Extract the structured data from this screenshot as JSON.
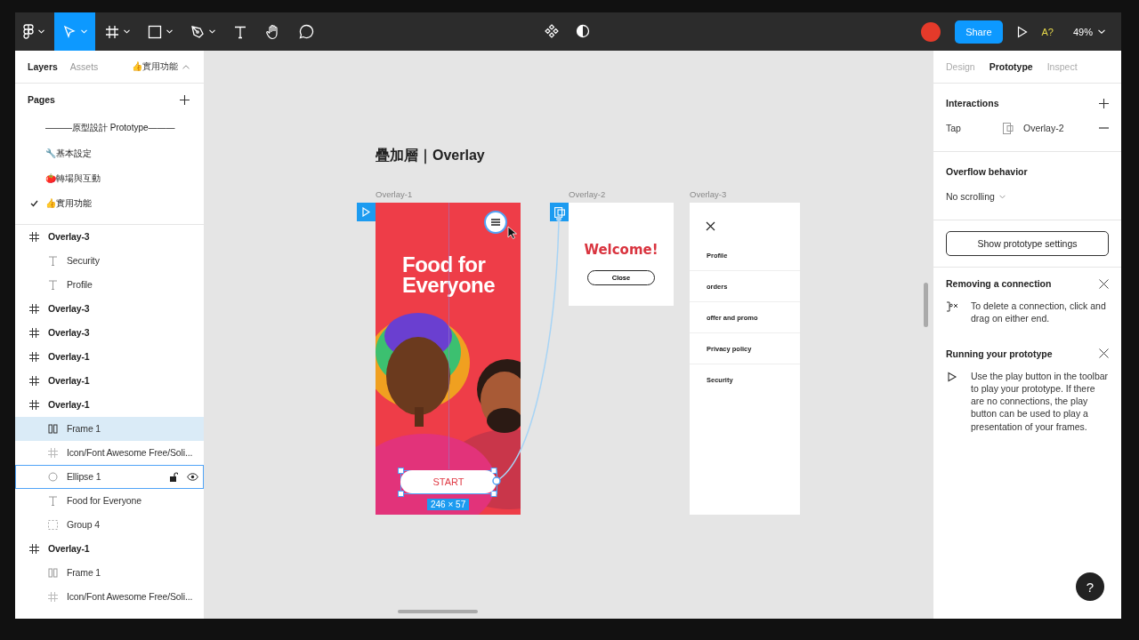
{
  "toolbar": {
    "tools": [
      {
        "kind": "menu",
        "selected": false
      },
      {
        "kind": "move",
        "selected": true
      },
      {
        "kind": "frame",
        "selected": false
      },
      {
        "kind": "shape",
        "selected": false
      },
      {
        "kind": "pen",
        "selected": false
      },
      {
        "kind": "text",
        "selected": false
      },
      {
        "kind": "hand",
        "selected": false
      },
      {
        "kind": "comment",
        "selected": false
      }
    ],
    "share": "Share",
    "badge": "A?",
    "zoom": "49%"
  },
  "left_panel": {
    "tabs": [
      {
        "label": "Layers",
        "selected": true
      },
      {
        "label": "Assets",
        "selected": false
      }
    ],
    "current_page": "👍實用功能",
    "pages_title": "Pages",
    "pages": [
      {
        "label": "———原型設計 Prototype———",
        "selected": false
      },
      {
        "label": "🔧基本設定",
        "selected": false
      },
      {
        "label": "🍅轉場與互動",
        "selected": false
      },
      {
        "label": "👍實用功能",
        "selected": true
      }
    ],
    "layers": [
      {
        "name": "Overlay-3",
        "kind": "frame",
        "selected": false,
        "hovered": false,
        "children": [
          {
            "name": "Security",
            "kind": "text",
            "selected": false,
            "hovered": false
          },
          {
            "name": "Profile",
            "kind": "text",
            "selected": false,
            "hovered": false
          }
        ]
      },
      {
        "name": "Overlay-3",
        "kind": "frame",
        "selected": false,
        "hovered": false
      },
      {
        "name": "Overlay-3",
        "kind": "frame",
        "selected": false,
        "hovered": false
      },
      {
        "name": "Overlay-1",
        "kind": "frame",
        "selected": false,
        "hovered": false
      },
      {
        "name": "Overlay-1",
        "kind": "frame",
        "selected": false,
        "hovered": false
      },
      {
        "name": "Overlay-1",
        "kind": "frame",
        "selected": false,
        "hovered": false,
        "children": [
          {
            "name": "Frame 1",
            "kind": "autolayout",
            "selected": true,
            "hovered": false
          },
          {
            "name": "Icon/Font Awesome Free/Soli...",
            "kind": "frame",
            "selected": false,
            "hovered": false
          },
          {
            "name": "Ellipse 1",
            "kind": "ellipse",
            "selected": false,
            "hovered": true
          },
          {
            "name": "Food for Everyone",
            "kind": "text",
            "selected": false,
            "hovered": false
          },
          {
            "name": "Group 4",
            "kind": "group",
            "selected": false,
            "hovered": false
          }
        ]
      },
      {
        "name": "Overlay-1",
        "kind": "frame",
        "selected": false,
        "hovered": false,
        "children": [
          {
            "name": "Frame 1",
            "kind": "autolayout",
            "selected": false,
            "hovered": false
          },
          {
            "name": "Icon/Font Awesome Free/Soli...",
            "kind": "frame",
            "selected": false,
            "hovered": false
          }
        ]
      }
    ]
  },
  "canvas": {
    "title": "疊加層｜Overlay",
    "frames": [
      {
        "label": "Overlay-1",
        "kind": "splash",
        "headline": "Food for Everyone",
        "button": "START",
        "size_badge": "246 × 57"
      },
      {
        "label": "Overlay-2",
        "kind": "dialog",
        "heading": "Welcome!",
        "button": "Close"
      },
      {
        "label": "Overlay-3",
        "kind": "menu",
        "items": [
          "Profile",
          "orders",
          "offer and promo",
          "Privacy policy",
          "Security"
        ]
      }
    ]
  },
  "right_panel": {
    "tabs": [
      {
        "label": "Design",
        "selected": false
      },
      {
        "label": "Prototype",
        "selected": true
      },
      {
        "label": "Inspect",
        "selected": false
      }
    ],
    "interactions_title": "Interactions",
    "interactions": [
      {
        "trigger": "Tap",
        "target": "Overlay-2"
      }
    ],
    "overflow_title": "Overflow behavior",
    "overflow_value": "No scrolling",
    "settings_button": "Show prototype settings",
    "tips": [
      {
        "kind": "connection",
        "title": "Removing a connection",
        "text": "To delete a connection, click and drag on either end."
      },
      {
        "kind": "play",
        "title": "Running your prototype",
        "text": "Use the play button in the toolbar to play your prototype. If there are no connections, the play button can be used to play a presentation of your frames."
      }
    ],
    "help": "?"
  }
}
